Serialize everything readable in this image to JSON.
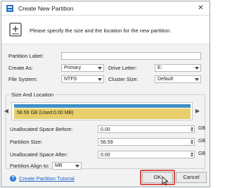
{
  "window": {
    "title": "Create New Partition",
    "close_glyph": "✕"
  },
  "header": {
    "instruction": "Please specify the size and the location for the new partition."
  },
  "form": {
    "partition_label": {
      "label": "Partition Label:",
      "value": ""
    },
    "create_as": {
      "label": "Create As:",
      "value": "Primary"
    },
    "drive_letter": {
      "label": "Drive Letter:",
      "value": "E:"
    },
    "file_system": {
      "label": "File System:",
      "value": "NTFS"
    },
    "cluster_size": {
      "label": "Cluster Size:",
      "value": "Default"
    }
  },
  "size_location": {
    "group_title": "Size And Location",
    "disk_text": "58.59 GB (Used:0.00 MB)",
    "disk_fill_fraction": 1.0,
    "unallocated_before": {
      "label": "Unallocated Space Before:",
      "value": "0.00",
      "unit": "GB"
    },
    "partition_size": {
      "label": "Partition Size:",
      "value": "58.59",
      "unit": "GB"
    },
    "unallocated_after": {
      "label": "Unallocated Space After:",
      "value": "0.00",
      "unit": "GB"
    },
    "align_to": {
      "label": "Partition Align to:",
      "value": "MB"
    }
  },
  "footer": {
    "help_link": "Create Partition Tutorial",
    "help_icon_glyph": "?",
    "ok_label": "OK",
    "cancel_label": "Cancel"
  },
  "colors": {
    "disk_bar_blue": "#3f8fc6",
    "disk_fill_yellow": "#e8cf6b",
    "ok_highlight": "#d9534f",
    "link": "#1f64c6"
  },
  "icons": [
    "partition-wizard-icon",
    "new-partition-icon",
    "close-icon",
    "dropdown-arrow-icon",
    "spin-up-icon",
    "spin-down-icon",
    "nav-left-icon",
    "nav-right-icon",
    "help-icon",
    "mouse-cursor-icon"
  ]
}
